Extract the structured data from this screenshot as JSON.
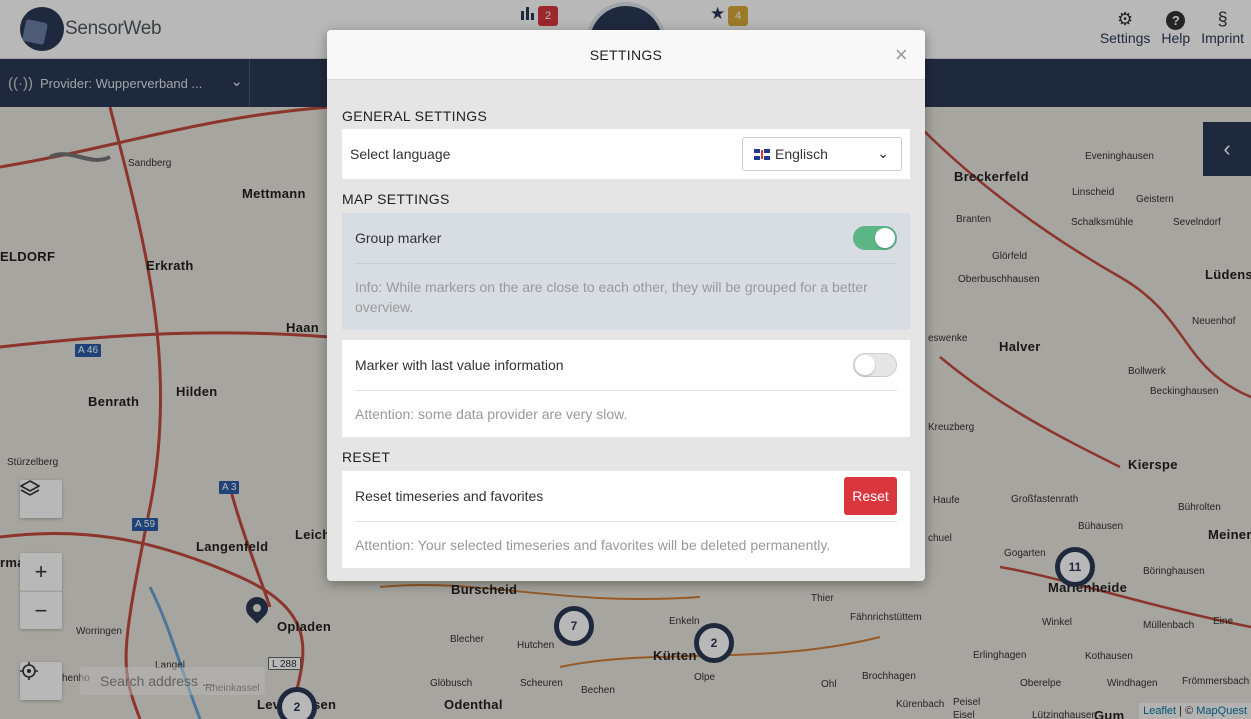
{
  "header": {
    "brand": "SensorWeb",
    "chart_badge": "2",
    "favorites_badge": "4",
    "menu": [
      {
        "label": "Settings",
        "icon": "gear-icon"
      },
      {
        "label": "Help",
        "icon": "question-circle-icon"
      },
      {
        "label": "Imprint",
        "icon": "paragraph-icon"
      }
    ]
  },
  "provider_bar": {
    "label": "Provider: Wupperverband ..."
  },
  "map": {
    "places": [
      "Mettmann",
      "ELDORF",
      "Erkrath",
      "Haan",
      "Hilden",
      "Benrath",
      "Langenfeld",
      "rmagen",
      "Opladen",
      "Leich",
      "Burscheid",
      "Kürten",
      "Odenthal",
      "Lev",
      "sen",
      "Breckerfeld",
      "Halver",
      "Kierspe",
      "Lüdens",
      "Meiner",
      "Marienheide",
      "Gum"
    ],
    "villages": [
      "Sandberg",
      "Stürzelberg",
      "Worringen",
      "Langel",
      "Rheinkassel",
      "henho",
      "Glöbusch",
      "Scheuren",
      "Bechen",
      "Hutchen",
      "Blecher",
      "Thier",
      "Enkeln",
      "Olpe",
      "Brochhagen",
      "Fähnrichstüttem",
      "Ohl",
      "Kürenbach",
      "Eveninghausen",
      "Linscheid",
      "Geistern",
      "Branten",
      "Schalksmühle",
      "Sevelndorf",
      "Glörfeld",
      "Oberbuschhausen",
      "Neuenhof",
      "Bollwerk",
      "Beckinghausen",
      "Kreuzberg",
      "Haufe",
      "Großfastenrath",
      "Bührolten",
      "Bühausen",
      "Gogarten",
      "Böringhausen",
      "Winkel",
      "Müllenbach",
      "Erlinghagen",
      "Kothausen",
      "Oberelpe",
      "Windhagen",
      "Frömmersbach",
      "Lützinghausen",
      "Eisel",
      "Peisel",
      "eswenke",
      "chuel",
      "Eine"
    ],
    "roads": [
      "A 46",
      "A 3",
      "A 59",
      "L 288"
    ],
    "clusters": [
      "7",
      "2",
      "11",
      "2"
    ],
    "search_placeholder": "Search address ...",
    "attribution_leaflet": "Leaflet",
    "attribution_sep": " | © ",
    "attribution_mapquest": "MapQuest"
  },
  "modal": {
    "title": "SETTINGS",
    "close": "×",
    "general": {
      "title": "GENERAL SETTINGS",
      "language_label": "Select language",
      "language_value": "Englisch"
    },
    "map_settings": {
      "title": "MAP SETTINGS",
      "group_marker_label": "Group marker",
      "group_marker_on": true,
      "group_marker_info": "Info: While markers on the are close to each other, they will be grouped for a better overview.",
      "last_value_label": "Marker with last value information",
      "last_value_on": false,
      "last_value_info": "Attention: some data provider are very slow."
    },
    "reset": {
      "title": "RESET",
      "label": "Reset timeseries and favorites",
      "button": "Reset",
      "info": "Attention: Your selected timeseries and favorites will be deleted permanently."
    }
  },
  "colors": {
    "primary": "#2b3a55",
    "danger": "#d9363e",
    "toggle_on": "#5cb585",
    "badge_amber": "#d9a93a"
  }
}
